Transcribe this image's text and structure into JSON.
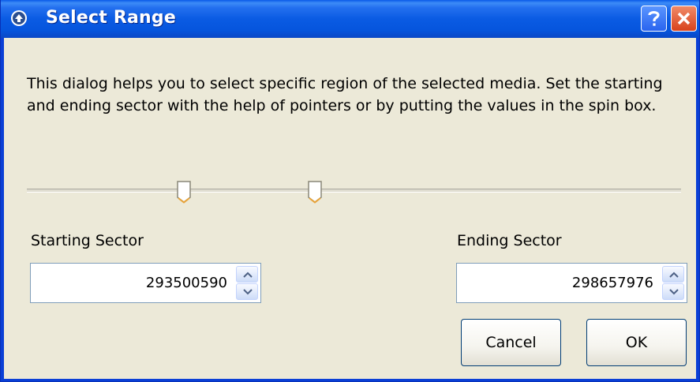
{
  "window": {
    "title": "Select Range",
    "help_icon": "question-mark-icon",
    "close_icon": "close-x-icon",
    "app_icon": "globe-arrow-icon"
  },
  "description": "This dialog helps you to select specific region of the selected media. Set the starting and ending sector with the help of pointers or by putting the values in the spin box.",
  "slider": {
    "start_handle_fraction": 0.24,
    "end_handle_fraction": 0.44
  },
  "starting_sector": {
    "label": "Starting Sector",
    "value": "293500590"
  },
  "ending_sector": {
    "label": "Ending Sector",
    "value": "298657976"
  },
  "buttons": {
    "cancel_label": "Cancel",
    "ok_label": "OK"
  },
  "colors": {
    "titlebar": "#0a5be3",
    "dialog_background": "#ece9d8",
    "close_button": "#d8421c"
  }
}
